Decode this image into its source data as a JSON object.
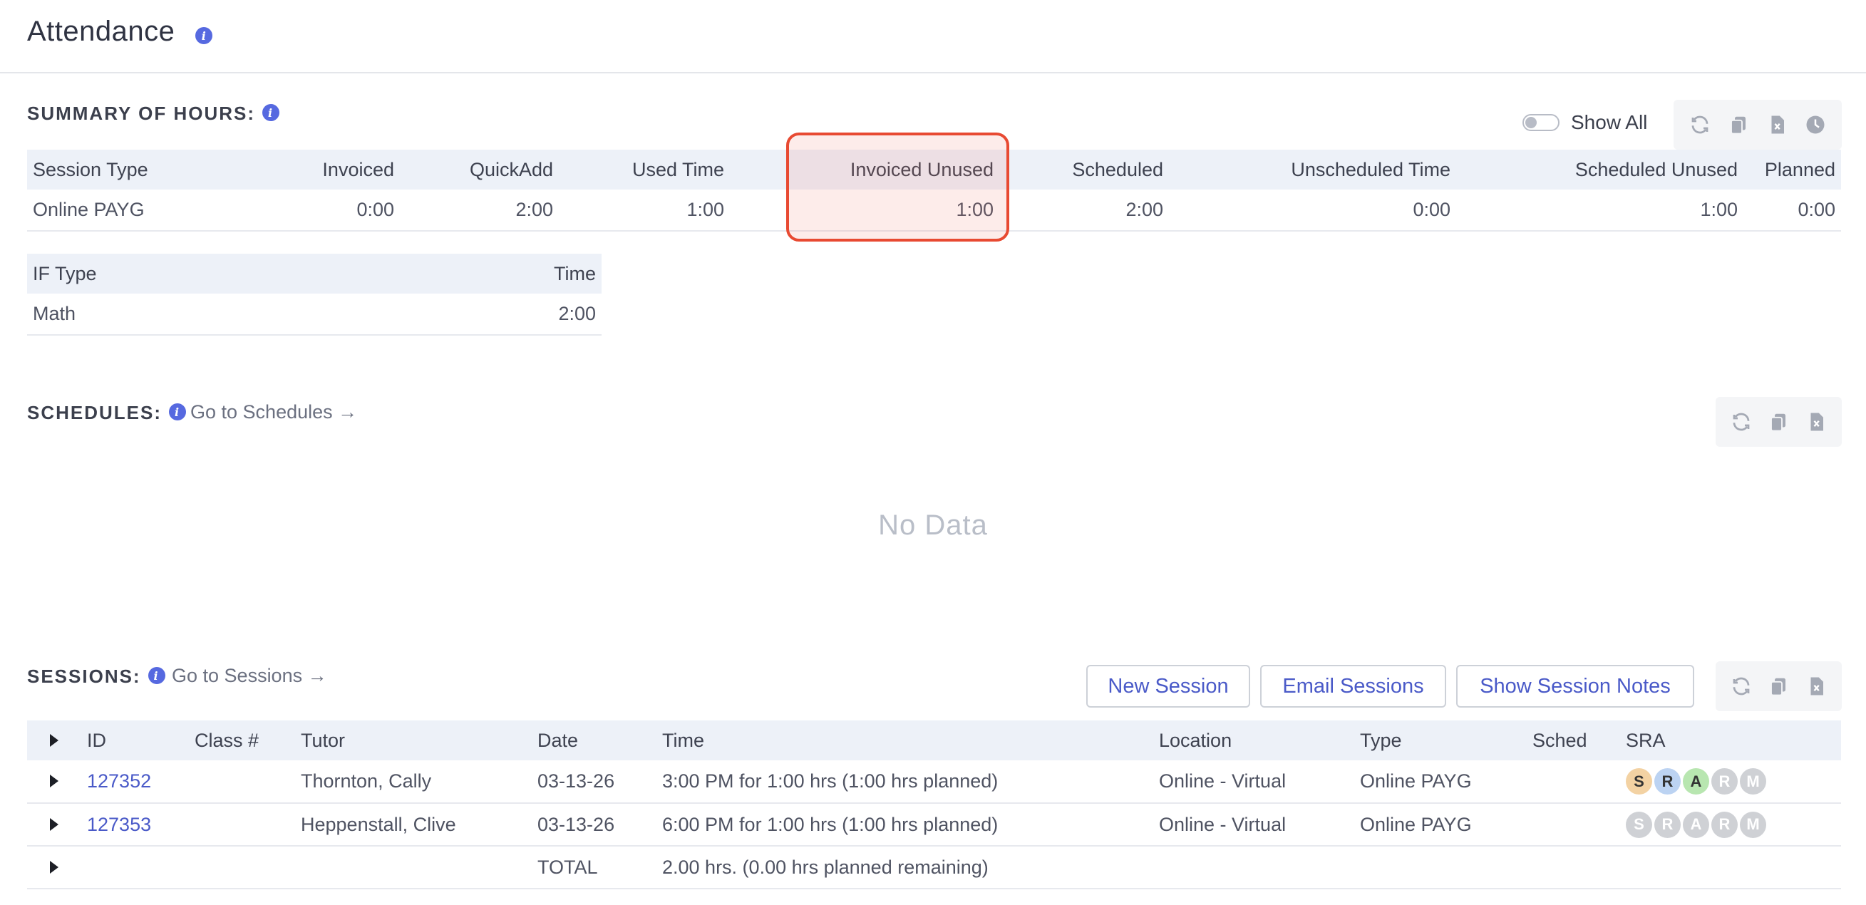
{
  "page": {
    "title": "Attendance"
  },
  "summary": {
    "title": "SUMMARY OF HOURS:",
    "show_all_label": "Show All",
    "columns": [
      "Session Type",
      "Invoiced",
      "QuickAdd",
      "Used Time",
      "Invoiced Unused",
      "Scheduled",
      "Unscheduled Time",
      "Scheduled Unused",
      "Planned"
    ],
    "row": [
      "Online PAYG",
      "0:00",
      "2:00",
      "1:00",
      "1:00",
      "2:00",
      "0:00",
      "1:00",
      "0:00"
    ],
    "highlighted_column": "Invoiced Unused"
  },
  "if_table": {
    "columns": [
      "IF Type",
      "Time"
    ],
    "row": [
      "Math",
      "2:00"
    ]
  },
  "schedules": {
    "title": "SCHEDULES:",
    "goto_label": "Go to Schedules →",
    "empty_text": "No Data"
  },
  "sessions": {
    "title": "SESSIONS:",
    "goto_label": "Go to Sessions →",
    "buttons": {
      "new": "New Session",
      "email": "Email Sessions",
      "notes": "Show Session Notes"
    },
    "columns": [
      "ID",
      "Class #",
      "Tutor",
      "Date",
      "Time",
      "Location",
      "Type",
      "Sched",
      "SRA"
    ],
    "rows": [
      {
        "id": "127352",
        "class": "",
        "tutor": "Thornton, Cally",
        "date": "03-13-26",
        "time": "3:00 PM for 1:00 hrs (1:00 hrs planned)",
        "location": "Online - Virtual",
        "type": "Online PAYG",
        "sched": "",
        "sra": [
          "S",
          "R",
          "A",
          "R",
          "M"
        ]
      },
      {
        "id": "127353",
        "class": "",
        "tutor": "Heppenstall, Clive",
        "date": "03-13-26",
        "time": "6:00 PM for 1:00 hrs (1:00 hrs planned)",
        "location": "Online - Virtual",
        "type": "Online PAYG",
        "sched": "",
        "sra": [
          "S",
          "R",
          "A",
          "R",
          "M"
        ]
      }
    ],
    "total": {
      "label": "TOTAL",
      "value": "2.00 hrs. (0.00 hrs planned remaining)"
    }
  },
  "icons": {
    "info": "info-icon",
    "toolbar": [
      "refresh-icon",
      "copy-icon",
      "excel-export-icon",
      "history-icon"
    ],
    "expand": "triangle-right-icon"
  },
  "colors": {
    "accent": "#5669e0",
    "highlight_border": "#e84a32",
    "link": "#4a5ac8"
  }
}
